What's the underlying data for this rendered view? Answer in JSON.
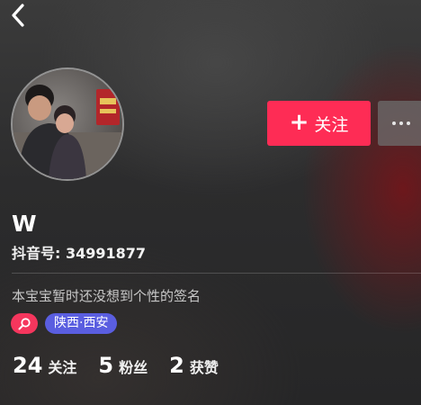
{
  "header": {
    "back_icon": "chevron-left-icon"
  },
  "profile": {
    "nickname": "W",
    "douyin_id": "抖音号: 34991877",
    "signature": "本宝宝暂时还没想到个性的签名",
    "location_tag": "陕西·西安"
  },
  "actions": {
    "follow_label": "关注",
    "follow_icon": "plus-icon",
    "more_icon": "more-dots-icon"
  },
  "stats": [
    {
      "value": "24",
      "label": "关注"
    },
    {
      "value": "5",
      "label": "粉丝"
    },
    {
      "value": "2",
      "label": "获赞"
    }
  ],
  "colors": {
    "follow_button": "#fe2c55",
    "search_tag": "#f5365d",
    "location_tag": "#5a5ee0"
  }
}
